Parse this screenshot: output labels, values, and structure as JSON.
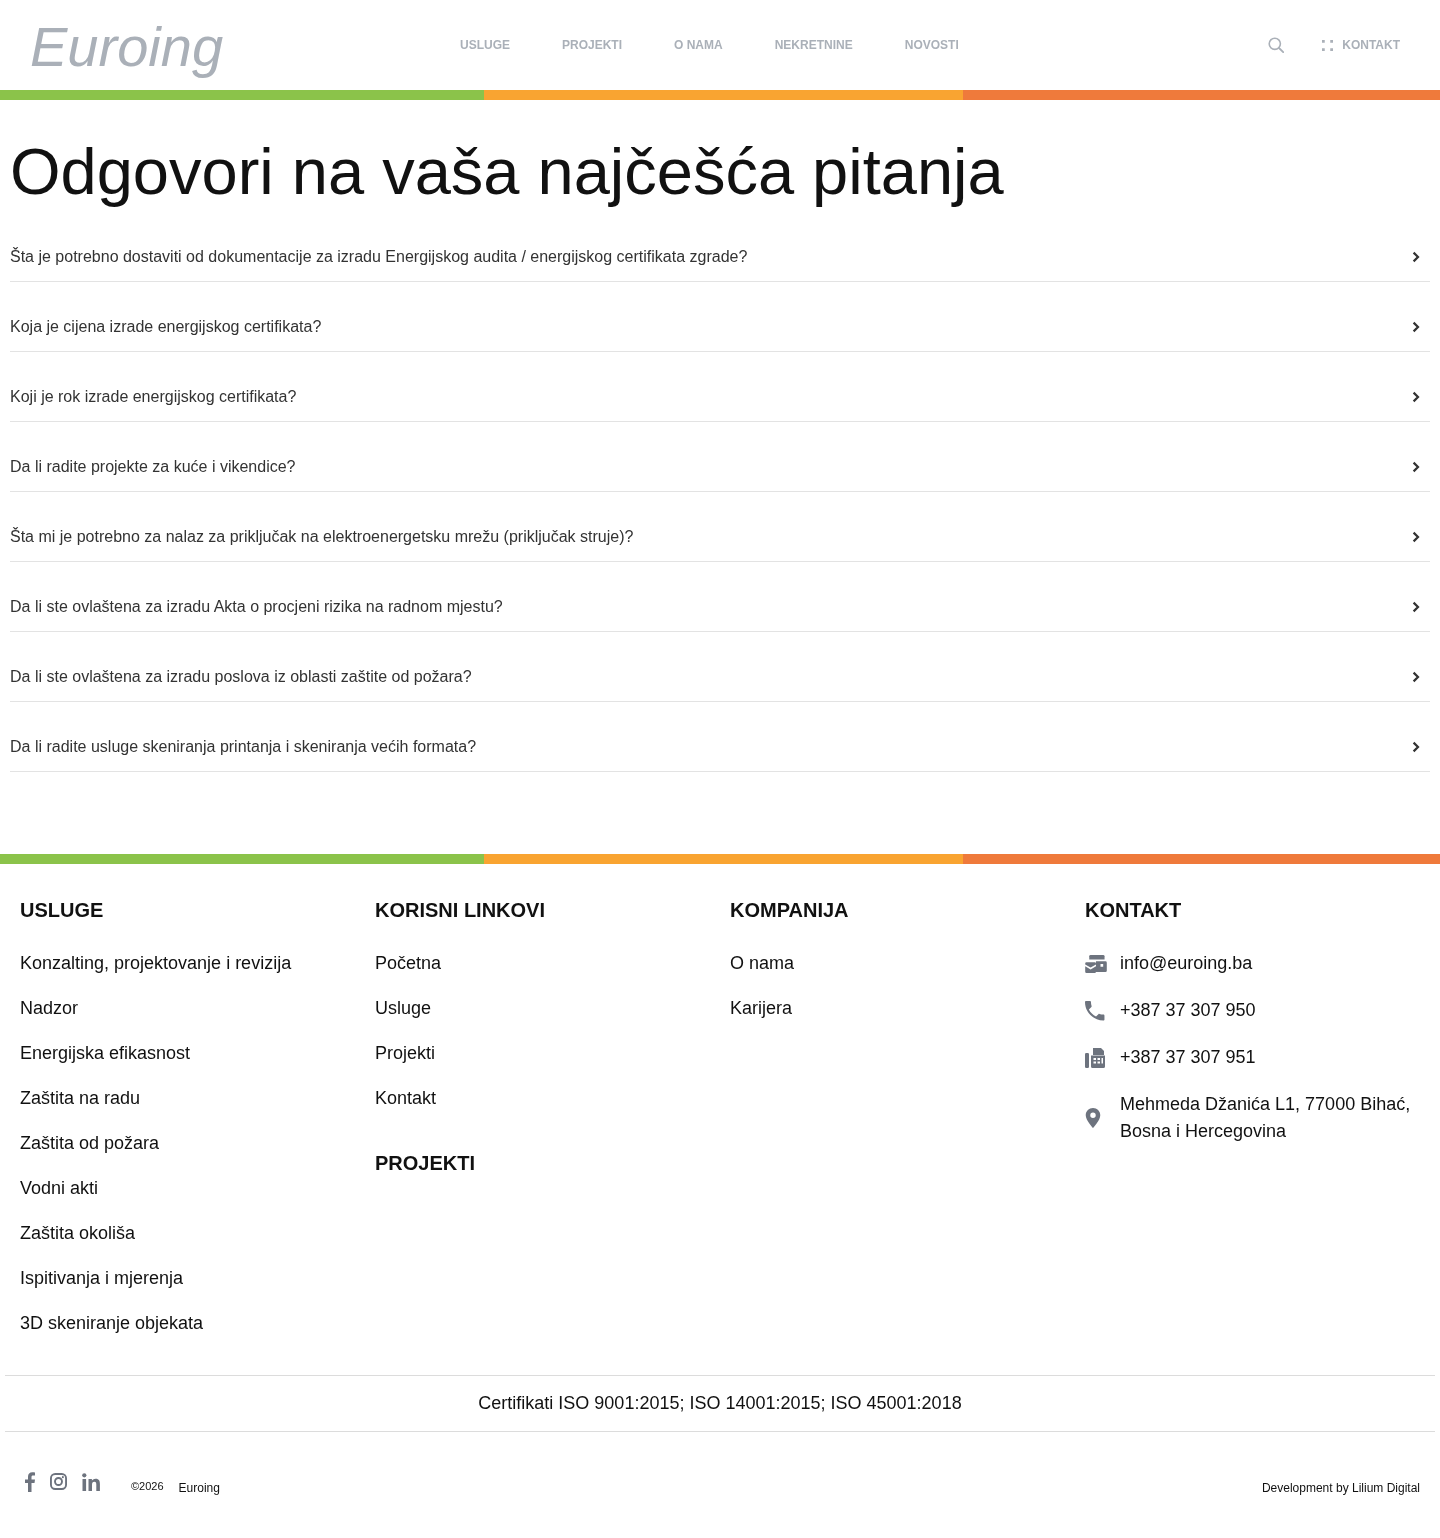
{
  "header": {
    "logo": "Euroing",
    "nav": [
      "USLUGE",
      "PROJEKTI",
      "O NAMA",
      "NEKRETNINE",
      "NOVOSTI"
    ],
    "contact_button": "KONTAKT"
  },
  "faq": {
    "title": "Odgovori na vaša najčešća pitanja",
    "items": [
      {
        "question": "Šta je potrebno dostaviti od dokumentacije za izradu Energijskog audita / energijskog certifikata zgrade?",
        "expanded": false
      },
      {
        "question": "Koja je cijena izrade energijskog certifikata?",
        "expanded": false
      },
      {
        "question": "Koji je rok izrade energijskog certifikata?",
        "expanded": false
      },
      {
        "question": "Da li radite projekte za kuće i vikendice?",
        "expanded": false
      },
      {
        "question": "Šta mi je potrebno za nalaz za priključak na elektroenergetsku mrežu (priključak struje)?",
        "expanded": false
      },
      {
        "question": "Da li ste ovlaštena za izradu Akta o procjeni rizika na radnom mjestu?",
        "expanded": false
      },
      {
        "question": "Da li ste ovlaštena za izradu poslova iz oblasti zaštite od požara?",
        "expanded": false
      },
      {
        "question": "Da li radite usluge skeniranja printanja i skeniranja većih formata?",
        "expanded": false
      }
    ]
  },
  "footer": {
    "columns": [
      {
        "sections": [
          {
            "heading": "USLUGE",
            "links": [
              "Konzalting, projektovanje i revizija",
              "Nadzor",
              "Energijska efikasnost",
              "Zaštita na radu",
              "Zaštita od požara",
              "Vodni akti",
              "Zaštita okoliša",
              "Ispitivanja i mjerenja",
              "3D skeniranje objekata"
            ]
          }
        ]
      },
      {
        "sections": [
          {
            "heading": "KORISNI LINKOVI",
            "links": [
              "Početna",
              "Usluge",
              "Projekti",
              "Kontakt"
            ]
          },
          {
            "heading": "PROJEKTI"
          }
        ]
      },
      {
        "sections": [
          {
            "heading": "KOMPANIJA",
            "links": [
              "O nama",
              "Karijera"
            ]
          }
        ]
      },
      {
        "sections": [
          {
            "heading": "KONTAKT",
            "contacts": [
              {
                "kind": "email",
                "text": "info@euroing.ba"
              },
              {
                "kind": "phone",
                "text": "+387 37 307 950"
              },
              {
                "kind": "fax",
                "text": "+387 37 307 951"
              },
              {
                "kind": "address",
                "text": "Mehmeda Džanića L1, 77000 Bihać, Bosna i Hercegovina"
              }
            ]
          }
        ]
      }
    ],
    "certificates": "Certifikati ISO 9001:2015; ISO 14001:2015; ISO 45001:2018",
    "copyright": "©2026",
    "company": "Euroing",
    "credit": "Development by Lilium Digital"
  }
}
